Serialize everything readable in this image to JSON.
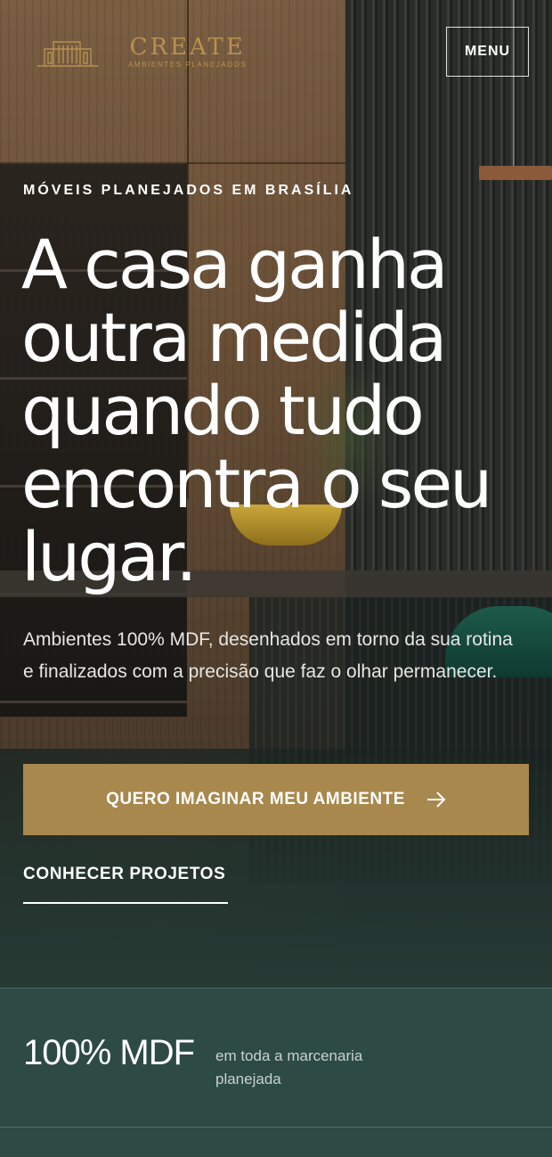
{
  "header": {
    "logo_title": "CREATE",
    "logo_subtitle": "AMBIENTES PLANEJADOS",
    "menu_label": "MENU"
  },
  "hero": {
    "eyebrow": "MÓVEIS PLANEJADOS EM BRASÍLIA",
    "headline": "A casa ganha outra medida quando tudo encontra o seu lugar.",
    "lead": "Ambientes 100% MDF, desenhados em torno da sua rotina e finalizados com a precisão que faz o olhar permanecer.",
    "cta_primary": "QUERO IMAGINAR MEU AMBIENTE",
    "cta_secondary": "CONHECER PROJETOS"
  },
  "stats": {
    "value": "100% MDF",
    "caption": "em toda a marcenaria planejada"
  },
  "colors": {
    "accent_gold": "#a8884c",
    "logo_gold": "#b8914f",
    "stats_green": "#2d4a44"
  },
  "icons": {
    "cta": "arrow-right-icon",
    "logo": "building-logo-icon"
  }
}
